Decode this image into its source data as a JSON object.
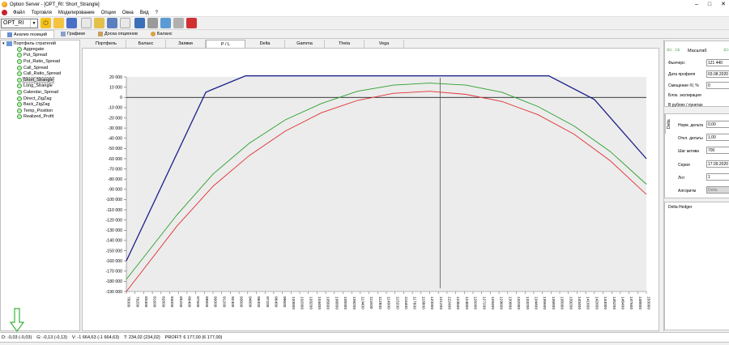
{
  "window": {
    "title": "Option Server - [OPT_RI: Short_Strangle]",
    "controls": [
      "‒",
      "□",
      "✕"
    ]
  },
  "menu": [
    "Файл",
    "Торговля",
    "Моделирование",
    "Опции",
    "Окна",
    "Вид",
    "?"
  ],
  "toolbar": {
    "instrument": "OPT_RI"
  },
  "main_tabs": [
    {
      "label": "Анализ позиций",
      "active": true
    },
    {
      "label": "Графики",
      "active": false
    },
    {
      "label": "Доска опционов",
      "active": false
    },
    {
      "label": "Баланс",
      "active": false
    }
  ],
  "tree": {
    "root": "Портфель стратегий",
    "items": [
      "Aggregate",
      "Put_Spread",
      "Put_Ratio_Spread",
      "Call_Spread",
      "Call_Ratio_Spread",
      "Short_Strangle",
      "Long_Strangle",
      "Calendar_Spread",
      "Direct_ZigZag",
      "Back_ZigZag",
      "Temp_Position",
      "Realized_Profit"
    ],
    "selected": "Short_Strangle"
  },
  "chart_tabs": [
    {
      "label": "Портфель",
      "active": false
    },
    {
      "label": "Баланс",
      "active": false
    },
    {
      "label": "Заявки",
      "active": false
    },
    {
      "label": "P / L",
      "active": true
    },
    {
      "label": "Delta",
      "active": false
    },
    {
      "label": "Gamma",
      "active": false
    },
    {
      "label": "Theta",
      "active": false
    },
    {
      "label": "Vega",
      "active": false
    }
  ],
  "right_panel": {
    "scale_label": "Масштаб",
    "futures_label": "Фьючерс",
    "futures_value": "121 440",
    "date_label": "Дата профиля",
    "date_value": "03.08.2020",
    "shift_label": "Смещение IV, %",
    "shift_value": "0",
    "expiry_label": "Блок. экспирация",
    "currency_label": "В рублях / пунктах",
    "side_tab": "Delta",
    "norm_delta_label": "Норм. дельта",
    "norm_delta_value": "0,00",
    "delta_dev_label": "Откл. дельты",
    "delta_dev_value": "1,00",
    "step_label": "Шаг актива",
    "step_value": "700",
    "series_label": "Серия",
    "series_value": "17.09.2020",
    "lot_label": "Лот",
    "lot_value": "1",
    "algo_label": "Алгоритм",
    "algo_value": "Delta",
    "hedger_label": "Delta Hedger"
  },
  "status": {
    "d": "D: -0,03  (-0,03)",
    "g": "G: -0,13  (-0,13)",
    "v": "V: -1 664,63  (-1 664,63)",
    "t": "T: 234,02  (234,02)",
    "profit": "PROFIT: 6 177,00  (6 177,00)"
  },
  "colors": {
    "expiry": "#1b1f8a",
    "today": "#e03030",
    "theoretical": "#2aa02a",
    "zero": "#000000",
    "cursor": "#555555"
  },
  "chart_data": {
    "type": "line",
    "x_min": 78000,
    "x_max": 150000,
    "x_step": 1200,
    "ylim": [
      -190000,
      20000
    ],
    "y_step": 10000,
    "y_ticks": [
      "20 000",
      "10 000",
      "0",
      "-10 000",
      "-20 000",
      "-30 000",
      "-40 000",
      "-50 000",
      "-60 000",
      "-70 000",
      "-80 000",
      "-90 000",
      "-100 000",
      "-110 000",
      "-120 000",
      "-130 000",
      "-140 000",
      "-150 000",
      "-160 000",
      "-170 000",
      "-180 000",
      "-190 000"
    ],
    "cursor_x": 121440,
    "series": [
      {
        "color": "#1b1f8a",
        "x": [
          78000,
          89000,
          90000,
          94500,
          136500,
          142800,
          150000
        ],
        "y": [
          -160000,
          5000,
          8000,
          21000,
          21000,
          -2000,
          -60000
        ]
      },
      {
        "color": "#2aa02a",
        "x": [
          78000,
          85000,
          90000,
          95000,
          100000,
          105000,
          110000,
          115000,
          120000,
          125000,
          130000,
          135000,
          140000,
          145000,
          150000
        ],
        "y": [
          -178000,
          -115000,
          -75000,
          -45000,
          -22000,
          -6000,
          6000,
          12000,
          14000,
          12000,
          5000,
          -9000,
          -28000,
          -53000,
          -85000
        ]
      },
      {
        "color": "#e03030",
        "x": [
          78000,
          85000,
          90000,
          95000,
          100000,
          105000,
          110000,
          115000,
          120000,
          125000,
          130000,
          135000,
          140000,
          145000,
          150000
        ],
        "y": [
          -190000,
          -126000,
          -87000,
          -57000,
          -33000,
          -15000,
          -3000,
          4000,
          6000,
          3000,
          -4000,
          -17000,
          -36000,
          -62000,
          -95000
        ]
      }
    ]
  }
}
